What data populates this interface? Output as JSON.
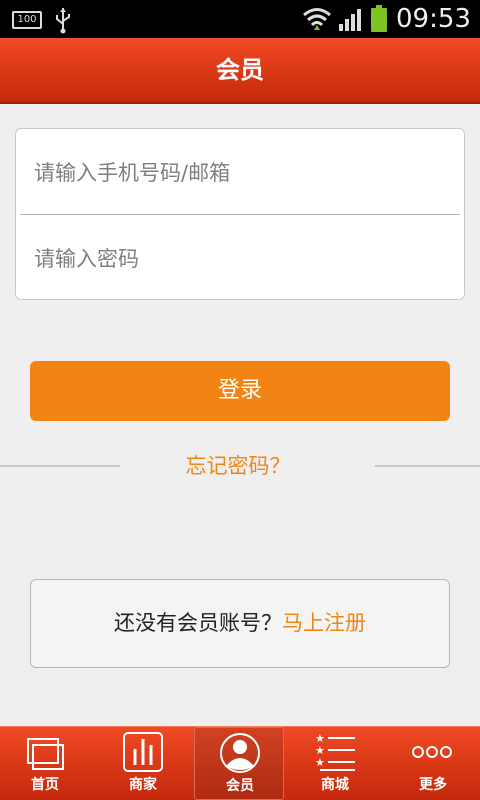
{
  "status_bar": {
    "battery_level": "100",
    "time": "09:53"
  },
  "header": {
    "title": "会员"
  },
  "form": {
    "phone_email_placeholder": "请输入手机号码/邮箱",
    "password_placeholder": "请输入密码"
  },
  "login_label": "登录",
  "forgot_password": "忘记密码？",
  "register": {
    "prompt": "还没有会员账号？",
    "link": "马上注册"
  },
  "bottom_nav": {
    "items": [
      {
        "label": "首页",
        "icon": "home-icon"
      },
      {
        "label": "商家",
        "icon": "merchants-icon"
      },
      {
        "label": "会员",
        "icon": "member-icon",
        "active": true
      },
      {
        "label": "商城",
        "icon": "mall-icon"
      },
      {
        "label": "更多",
        "icon": "more-icon"
      }
    ]
  },
  "colors": {
    "brand_red": "#e03a18",
    "accent_orange": "#f28413"
  }
}
